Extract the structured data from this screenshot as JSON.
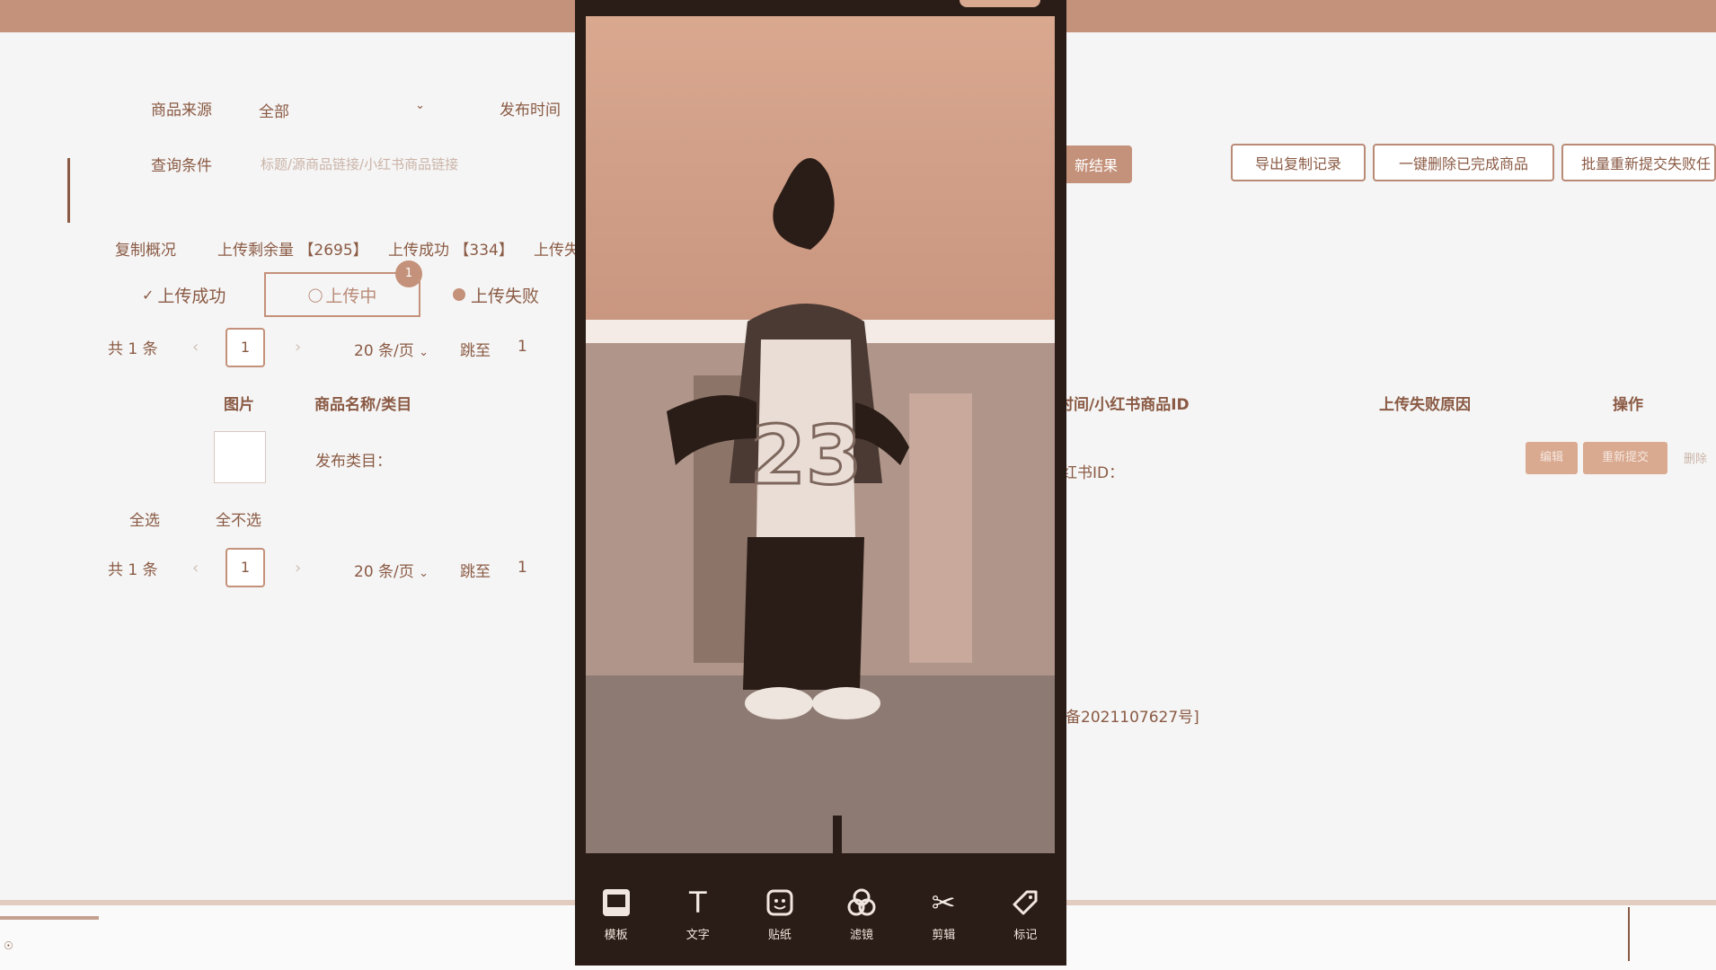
{
  "filters": {
    "source_label": "商品来源",
    "source_value": "全部",
    "publish_time_label": "发布时间",
    "query_label": "查询条件",
    "query_placeholder": "标题/源商品链接/小红书商品链接",
    "search_button_partial": "新结果"
  },
  "actions": {
    "export": "导出复制记录",
    "delete_done": "一键删除已完成商品",
    "resubmit": "批量重新提交失败任"
  },
  "overview": {
    "title": "复制概况",
    "remaining": "上传剩余量 【2695】",
    "success": "上传成功 【334】",
    "fail_partial": "上传失"
  },
  "tabs": {
    "success": "上传成功",
    "uploading": "上传中",
    "uploading_count": "1",
    "failed": "上传失败"
  },
  "pagination": {
    "total": "共 1 条",
    "page": "1",
    "per_page": "20 条/页",
    "jump_label": "跳至",
    "jump_value": "1"
  },
  "table": {
    "col_image": "图片",
    "col_name": "商品名称/类目",
    "col_time_id": "时间/小红书商品ID",
    "col_reason": "上传失败原因",
    "col_ops": "操作",
    "row_category": "发布类目：",
    "row_xhs_id": "红书ID：",
    "op_edit": "编辑",
    "op_retry": "重新提交",
    "op_delete": "删除"
  },
  "selection": {
    "select_all": "全选",
    "select_none": "全不选"
  },
  "footer": {
    "icp_partial": "备2021107627号]"
  },
  "phone_overlay": {
    "jersey_number": "23",
    "tools": [
      {
        "icon": "template-icon",
        "label": "模板"
      },
      {
        "icon": "text-icon",
        "label": "文字"
      },
      {
        "icon": "sticker-icon",
        "label": "贴纸"
      },
      {
        "icon": "filter-icon",
        "label": "滤镜"
      },
      {
        "icon": "scissors-icon",
        "label": "剪辑"
      },
      {
        "icon": "tag-icon",
        "label": "标记"
      }
    ]
  },
  "colors": {
    "accent": "#c4917a",
    "text": "#8a5a44",
    "phone_bg": "#2a1d17"
  }
}
